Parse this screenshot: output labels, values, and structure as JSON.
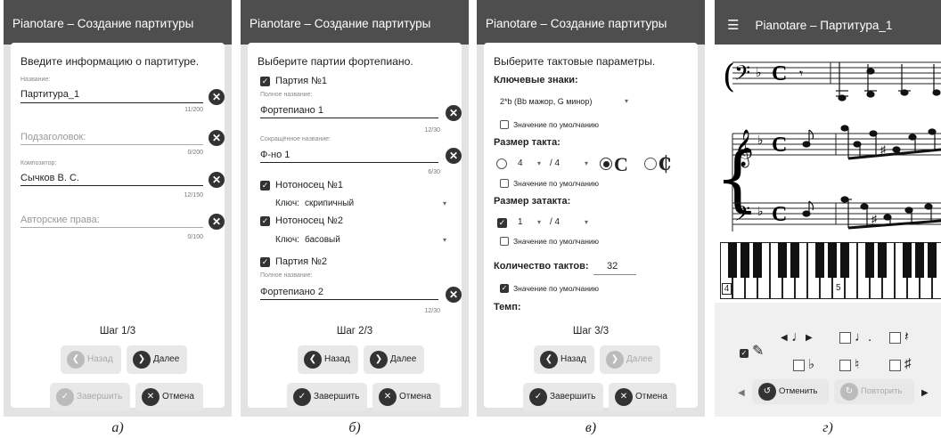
{
  "panels": [
    {
      "title": "Pianotare – Создание партитуры",
      "caption": "а)",
      "heading": "Введите информацию о партитуре.",
      "fields": [
        {
          "hint": "Название:",
          "value": "Партитура_1",
          "placeholder": "",
          "count": "11/200"
        },
        {
          "hint": "",
          "value": "",
          "placeholder": "Подзаголовок:",
          "count": "0/200"
        },
        {
          "hint": "Композитор:",
          "value": "Сычков В. С.",
          "placeholder": "",
          "count": "12/150"
        },
        {
          "hint": "",
          "value": "",
          "placeholder": "Авторские права:",
          "count": "0/100"
        }
      ],
      "step": "Шаг 1/3",
      "back": "Назад",
      "next": "Далее",
      "finish": "Завершить",
      "cancel": "Отмена"
    },
    {
      "title": "Pianotare – Создание партитуры",
      "caption": "б)",
      "heading": "Выберите партии фортепиано.",
      "part1": "Партия №1",
      "full_hint": "Полное название:",
      "part1_full": "Фортепиано 1",
      "part1_full_count": "12/30",
      "short_hint": "Сокращённое название:",
      "part1_short": "Ф-но 1",
      "part1_short_count": "6/30",
      "staff1": "Нотоносец №1",
      "clef_label": "Ключ:",
      "clef1": "скрипичный",
      "staff2": "Нотоносец №2",
      "clef2": "басовый",
      "part2": "Партия №2",
      "part2_full": "Фортепиано 2",
      "part2_full_count": "12/30",
      "step": "Шаг 2/3",
      "back": "Назад",
      "next": "Далее",
      "finish": "Завершить",
      "cancel": "Отмена"
    },
    {
      "title": "Pianotare – Создание партитуры",
      "caption": "в)",
      "heading": "Выберите тактовые параметры.",
      "key_label": "Ключевые знаки:",
      "key_value": "2*b (Bb мажор, G минор)",
      "default_label": "Значение по умолчанию",
      "time_label": "Размер такта:",
      "time_num": "4",
      "time_den": "/ 4",
      "common_symbol": "C",
      "cut_symbol": "₵",
      "pickup_label": "Размер затакта:",
      "pickup_num": "1",
      "pickup_den": "/ 4",
      "measures_label": "Количество тактов:",
      "measures_value": "32",
      "tempo_label": "Темп:",
      "step": "Шаг 3/3",
      "back": "Назад",
      "next": "Далее",
      "finish": "Завершить",
      "cancel": "Отмена"
    },
    {
      "title": "Pianotare – Партитура_1",
      "caption": "г)",
      "measure_a": "4",
      "measure_b": "5",
      "undo": "Отменить",
      "redo": "Повторить"
    }
  ]
}
